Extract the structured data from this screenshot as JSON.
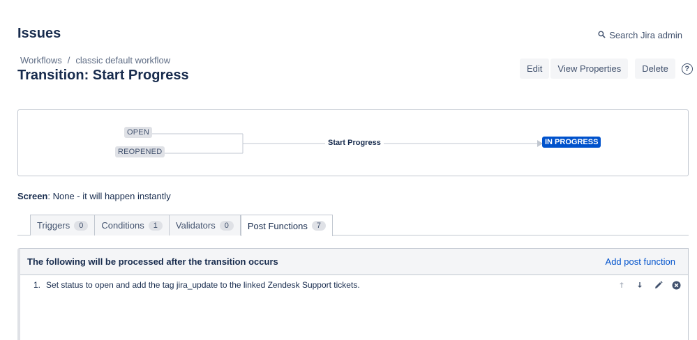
{
  "header": {
    "title": "Issues",
    "search_label": "Search Jira admin"
  },
  "breadcrumb": {
    "items": [
      "Workflows",
      "classic default workflow"
    ],
    "separator": "/"
  },
  "transition": {
    "title": "Transition: Start Progress"
  },
  "actions": {
    "edit": "Edit",
    "view_properties": "View Properties",
    "delete": "Delete",
    "help": "?"
  },
  "diagram": {
    "from_statuses": [
      "OPEN",
      "REOPENED"
    ],
    "transition_name": "Start Progress",
    "to_status": "IN PROGRESS",
    "to_status_color": "#0052cc"
  },
  "screen": {
    "label": "Screen",
    "value": ": None - it will happen instantly"
  },
  "tabs": [
    {
      "label": "Triggers",
      "count": "0"
    },
    {
      "label": "Conditions",
      "count": "1"
    },
    {
      "label": "Validators",
      "count": "0"
    },
    {
      "label": "Post Functions",
      "count": "7",
      "active": true
    }
  ],
  "panel": {
    "heading": "The following will be processed after the transition occurs",
    "add_label": "Add post function",
    "items": [
      {
        "number": "1.",
        "text": "Set status to open and add the tag jira_update to the linked Zendesk Support tickets."
      }
    ]
  },
  "icons": {
    "search": "search-icon",
    "move_up": "arrow-up-icon",
    "move_down": "arrow-down-icon",
    "edit": "pencil-icon",
    "delete": "close-circle-icon",
    "help": "help-icon"
  }
}
